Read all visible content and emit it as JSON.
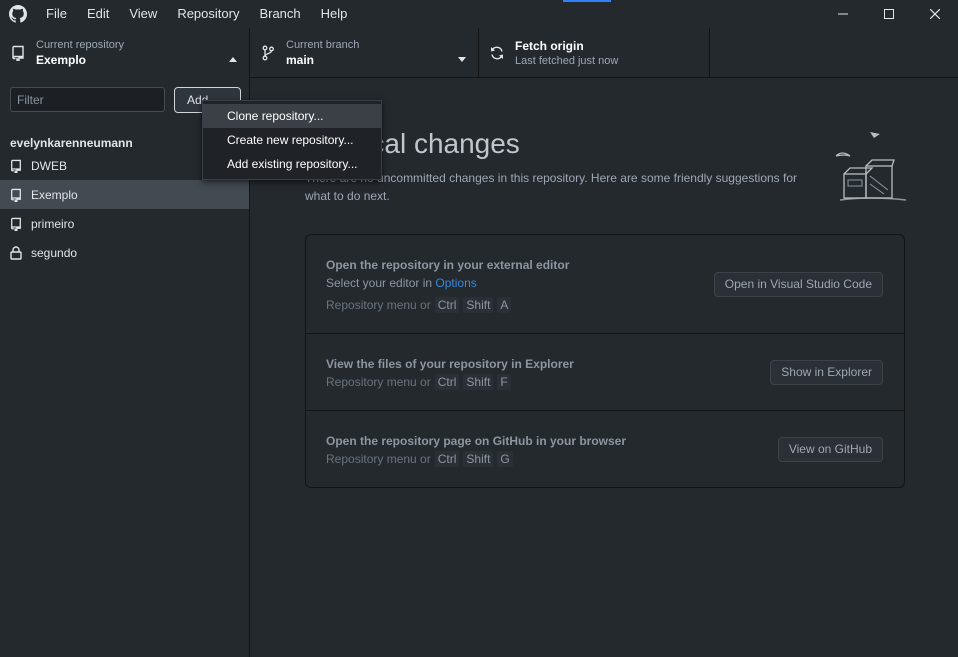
{
  "menu": [
    "File",
    "Edit",
    "View",
    "Repository",
    "Branch",
    "Help"
  ],
  "toolbar": {
    "repo_label": "Current repository",
    "repo_value": "Exemplo",
    "branch_label": "Current branch",
    "branch_value": "main",
    "fetch_label": "Fetch origin",
    "fetch_sub": "Last fetched just now"
  },
  "sidebar": {
    "filter_placeholder": "Filter",
    "add_label": "Add",
    "group_header": "evelynkarenneumann",
    "repos": [
      {
        "name": "DWEB",
        "icon": "repo-icon",
        "selected": false
      },
      {
        "name": "Exemplo",
        "icon": "repo-icon",
        "selected": true
      },
      {
        "name": "primeiro",
        "icon": "repo-icon",
        "selected": false
      },
      {
        "name": "segundo",
        "icon": "lock-icon",
        "selected": false
      }
    ]
  },
  "dropdown": {
    "items": [
      "Clone repository...",
      "Create new repository...",
      "Add existing repository..."
    ]
  },
  "main": {
    "heading": "No local changes",
    "subtext": "There are no uncommitted changes in this repository. Here are some friendly suggestions for what to do next.",
    "suggestions": [
      {
        "title": "Open the repository in your external editor",
        "desc_prefix": "Select your editor in ",
        "desc_link": "Options",
        "shortcut_prefix": "Repository menu or",
        "keys": [
          "Ctrl",
          "Shift",
          "A"
        ],
        "button": "Open in Visual Studio Code"
      },
      {
        "title": "View the files of your repository in Explorer",
        "shortcut_prefix": "Repository menu or",
        "keys": [
          "Ctrl",
          "Shift",
          "F"
        ],
        "button": "Show in Explorer"
      },
      {
        "title": "Open the repository page on GitHub in your browser",
        "shortcut_prefix": "Repository menu or",
        "keys": [
          "Ctrl",
          "Shift",
          "G"
        ],
        "button": "View on GitHub"
      }
    ]
  },
  "colors": {
    "background": "#24292e",
    "selected_row": "#434a52",
    "link": "#3a86d6",
    "accent": "#2f81f7"
  }
}
